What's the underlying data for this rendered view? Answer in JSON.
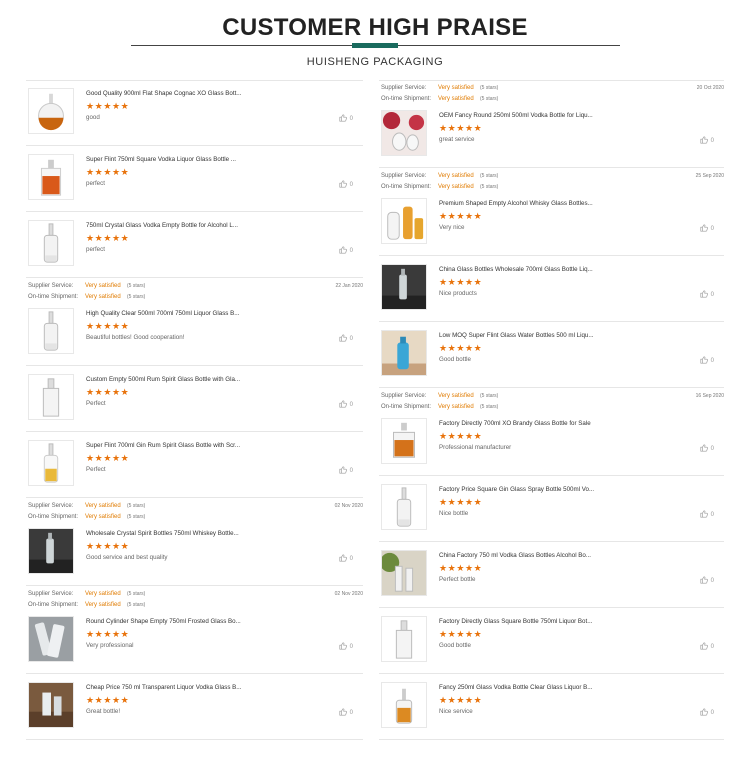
{
  "header": {
    "title": "CUSTOMER HIGH PRAISE",
    "subtitle": "HUISHENG PACKAGING"
  },
  "meta_labels": {
    "supplier": "Supplier Service:",
    "ontime": "On-time Shipment:",
    "stars_note": "(5 stars)"
  },
  "colors": {
    "accent": "#1a6b5e",
    "star": "#e8730c",
    "satisfied": "#e07b00"
  },
  "left_column": [
    {
      "type": "product",
      "name": "Good Quality 900ml Flat Shape Cognac XO Glass Bott...",
      "stars": "★★★★★",
      "comment": "good",
      "likes": "0",
      "thumb": "cognac-round"
    },
    {
      "type": "product",
      "name": "Super Flint 750ml Square Vodka Liquor Glass Bottle ...",
      "stars": "★★★★★",
      "comment": "perfect",
      "likes": "0",
      "thumb": "square-amber"
    },
    {
      "type": "product",
      "name": "750ml Crystal Glass Vodka Empty Bottle for Alcohol L...",
      "stars": "★★★★★",
      "comment": "perfect",
      "likes": "0",
      "thumb": "tall-clear"
    },
    {
      "type": "meta",
      "supplier_value": "Very satisfied",
      "ontime_value": "Very satisfied",
      "date": "22 Jan 2020"
    },
    {
      "type": "product",
      "name": "High Quality Clear 500ml 700ml 750ml Liquor Glass B...",
      "stars": "★★★★★",
      "comment": "Beautiful bottles! Good cooperation!",
      "likes": "0",
      "thumb": "tall-clear"
    },
    {
      "type": "product",
      "name": "Custom Empty 500ml Rum Spirit Glass Bottle with Gla...",
      "stars": "★★★★★",
      "comment": "Perfect",
      "likes": "0",
      "thumb": "square-clear"
    },
    {
      "type": "product",
      "name": "Super Flint 700ml Gin Rum Spirit Glass Bottle with Scr...",
      "stars": "★★★★★",
      "comment": "Perfect",
      "likes": "0",
      "thumb": "tall-yellow"
    },
    {
      "type": "meta",
      "supplier_value": "Very satisfied",
      "ontime_value": "Very satisfied",
      "date": "02 Nov 2020"
    },
    {
      "type": "product",
      "name": "Wholesale Crystal Spirit Bottles 750ml Whiskey Bottle...",
      "stars": "★★★★★",
      "comment": "Good service and best quality",
      "likes": "0",
      "thumb": "dark-scene"
    },
    {
      "type": "meta",
      "supplier_value": "Very satisfied",
      "ontime_value": "Very satisfied",
      "date": "02 Nov 2020"
    },
    {
      "type": "product",
      "name": "Round Cylinder Shape Empty 750ml Frosted Glass Bo...",
      "stars": "★★★★★",
      "comment": "Very professional",
      "likes": "0",
      "thumb": "frosted"
    },
    {
      "type": "product",
      "name": "Cheap Price 750 ml Transparent Liquor Vodka Glass B...",
      "stars": "★★★★★",
      "comment": "Great bottle!",
      "likes": "0",
      "thumb": "bottle-scene"
    }
  ],
  "right_column": [
    {
      "type": "meta",
      "supplier_value": "Very satisfied",
      "ontime_value": "Very satisfied",
      "date": "20 Oct 2020"
    },
    {
      "type": "product",
      "name": "OEM Fancy Round 250ml 500ml Vodka Bottle for Liqu...",
      "stars": "★★★★★",
      "comment": "great service",
      "likes": "0",
      "thumb": "red-scene"
    },
    {
      "type": "meta",
      "supplier_value": "Very satisfied",
      "ontime_value": "Very satisfied",
      "date": "25 Sep 2020"
    },
    {
      "type": "product",
      "name": "Premium Shaped Empty Alcohol Whisky Glass Bottles...",
      "stars": "★★★★★",
      "comment": "Very nice",
      "likes": "0",
      "thumb": "amber-group"
    },
    {
      "type": "product",
      "name": "China Glass Bottles Wholesale 700ml Glass Bottle Liq...",
      "stars": "★★★★★",
      "comment": "Nice products",
      "likes": "0",
      "thumb": "dark-scene"
    },
    {
      "type": "product",
      "name": "Low MOQ Super Flint Glass Water Bottles 500 ml Liqu...",
      "stars": "★★★★★",
      "comment": "Good bottle",
      "likes": "0",
      "thumb": "blue-scene"
    },
    {
      "type": "meta",
      "supplier_value": "Very satisfied",
      "ontime_value": "Very satisfied",
      "date": "16 Sep 2020"
    },
    {
      "type": "product",
      "name": "Factory Directly 700ml XO Brandy Glass Bottle for Sale",
      "stars": "★★★★★",
      "comment": "Professional manufacturer",
      "likes": "0",
      "thumb": "cognac-flask"
    },
    {
      "type": "product",
      "name": "Factory Price Square Gin Glass Spray Bottle 500ml Vo...",
      "stars": "★★★★★",
      "comment": "Nice bottle",
      "likes": "0",
      "thumb": "tall-clear"
    },
    {
      "type": "product",
      "name": "China Factory 750 ml Vodka Glass Bottles Alcohol Bo...",
      "stars": "★★★★★",
      "comment": "Perfect bottle",
      "likes": "0",
      "thumb": "green-scene"
    },
    {
      "type": "product",
      "name": "Factory Directly Glass Square Bottle 750ml Liquor Bot...",
      "stars": "★★★★★",
      "comment": "Good bottle",
      "likes": "0",
      "thumb": "square-clear"
    },
    {
      "type": "product",
      "name": "Fancy 250ml Glass Vodka Bottle Clear Glass Liquor B...",
      "stars": "★★★★★",
      "comment": "Nice service",
      "likes": "0",
      "thumb": "small-amber"
    }
  ]
}
